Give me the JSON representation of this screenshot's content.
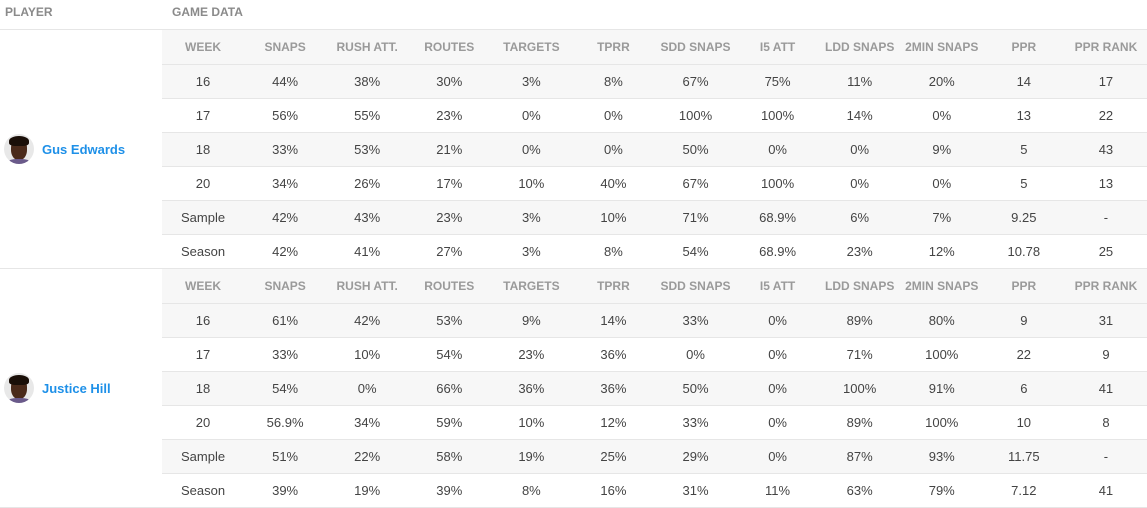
{
  "header": {
    "player_label": "PLAYER",
    "game_data_label": "GAME DATA"
  },
  "columns": [
    "WEEK",
    "SNAPS",
    "RUSH ATT.",
    "ROUTES",
    "TARGETS",
    "TPRR",
    "SDD SNAPS",
    "I5 ATT",
    "LDD SNAPS",
    "2MIN SNAPS",
    "PPR",
    "PPR RANK"
  ],
  "players": [
    {
      "name": "Gus Edwards",
      "avatar_icon": "player-headshot",
      "rows": [
        [
          "16",
          "44%",
          "38%",
          "30%",
          "3%",
          "8%",
          "67%",
          "75%",
          "11%",
          "20%",
          "14",
          "17"
        ],
        [
          "17",
          "56%",
          "55%",
          "23%",
          "0%",
          "0%",
          "100%",
          "100%",
          "14%",
          "0%",
          "13",
          "22"
        ],
        [
          "18",
          "33%",
          "53%",
          "21%",
          "0%",
          "0%",
          "50%",
          "0%",
          "0%",
          "9%",
          "5",
          "43"
        ],
        [
          "20",
          "34%",
          "26%",
          "17%",
          "10%",
          "40%",
          "67%",
          "100%",
          "0%",
          "0%",
          "5",
          "13"
        ],
        [
          "Sample",
          "42%",
          "43%",
          "23%",
          "3%",
          "10%",
          "71%",
          "68.9%",
          "6%",
          "7%",
          "9.25",
          "-"
        ],
        [
          "Season",
          "42%",
          "41%",
          "27%",
          "3%",
          "8%",
          "54%",
          "68.9%",
          "23%",
          "12%",
          "10.78",
          "25"
        ]
      ]
    },
    {
      "name": "Justice Hill",
      "avatar_icon": "player-headshot",
      "rows": [
        [
          "16",
          "61%",
          "42%",
          "53%",
          "9%",
          "14%",
          "33%",
          "0%",
          "89%",
          "80%",
          "9",
          "31"
        ],
        [
          "17",
          "33%",
          "10%",
          "54%",
          "23%",
          "36%",
          "0%",
          "0%",
          "71%",
          "100%",
          "22",
          "9"
        ],
        [
          "18",
          "54%",
          "0%",
          "66%",
          "36%",
          "36%",
          "50%",
          "0%",
          "100%",
          "91%",
          "6",
          "41"
        ],
        [
          "20",
          "56.9%",
          "34%",
          "59%",
          "10%",
          "12%",
          "33%",
          "0%",
          "89%",
          "100%",
          "10",
          "8"
        ],
        [
          "Sample",
          "51%",
          "22%",
          "58%",
          "19%",
          "25%",
          "29%",
          "0%",
          "87%",
          "93%",
          "11.75",
          "-"
        ],
        [
          "Season",
          "39%",
          "19%",
          "39%",
          "8%",
          "16%",
          "31%",
          "11%",
          "63%",
          "79%",
          "7.12",
          "41"
        ]
      ]
    }
  ],
  "colors": {
    "player_link": "#1e90e8",
    "header_text": "#9a9a9a",
    "stripe": "#f7f7f7"
  }
}
